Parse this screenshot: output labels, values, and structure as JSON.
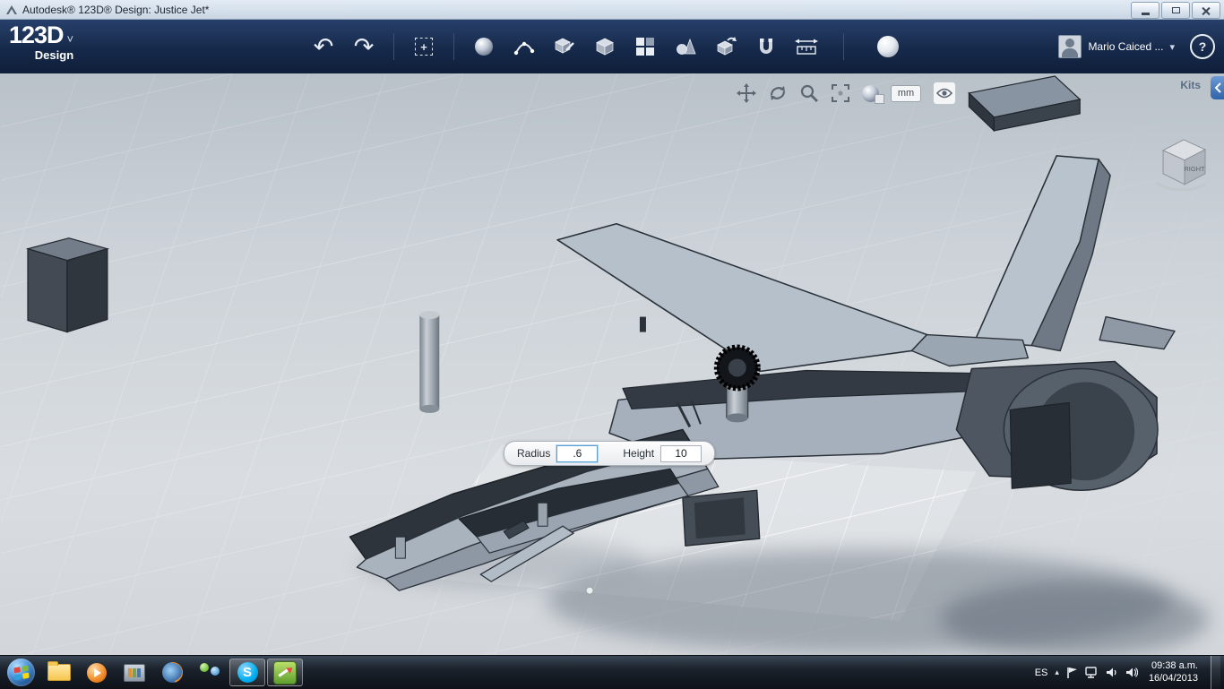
{
  "window": {
    "title": "Autodesk® 123D® Design: Justice Jet*"
  },
  "brand": {
    "logo": "123D",
    "sub": "Design",
    "carat": "˅"
  },
  "toolbar": {
    "icons": [
      {
        "name": "undo-icon",
        "glyph": "↶"
      },
      {
        "name": "redo-icon",
        "glyph": "↷"
      },
      {
        "name": "move-transform-icon"
      },
      {
        "name": "primitives-icon"
      },
      {
        "name": "sketch-icon"
      },
      {
        "name": "construct-icon"
      },
      {
        "name": "solid-icon"
      },
      {
        "name": "pattern-icon"
      },
      {
        "name": "grouping-icon"
      },
      {
        "name": "combine-icon"
      },
      {
        "name": "snap-icon"
      },
      {
        "name": "measure-icon"
      },
      {
        "name": "material-icon"
      }
    ]
  },
  "account": {
    "name": "Mario Caiced ...",
    "carat": "▾",
    "help_label": "?"
  },
  "viewport": {
    "kits_label": "Kits",
    "units_label": "mm",
    "view_cube_face": "RIGHT",
    "nav_icons": [
      "pan-icon",
      "orbit-icon",
      "zoom-icon",
      "fit-view-icon",
      "material-icon",
      "units-button",
      "visibility-eye-icon"
    ]
  },
  "dialog": {
    "radius_label": "Radius",
    "radius_value": ".6",
    "height_label": "Height",
    "height_value": "10"
  },
  "taskbar": {
    "tray": {
      "language": "ES",
      "carat": "▴",
      "time": "09:38 a.m.",
      "date": "16/04/2013"
    }
  },
  "colors": {
    "appbar": "#16294a",
    "viewport_bg": "#ccd2d8",
    "model_light": "#b6c0cb",
    "model_dark": "#2e343c",
    "accent_blue": "#3f74b8",
    "dialog_focus": "#5a9fd4"
  }
}
